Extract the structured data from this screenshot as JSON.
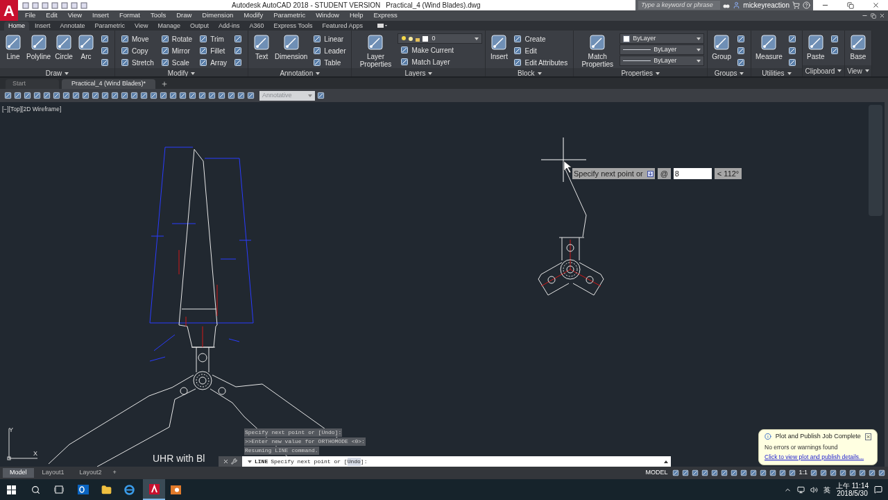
{
  "title_bar": {
    "logo": "A",
    "title": "Autodesk AutoCAD 2018 - STUDENT VERSION",
    "file": "Practical_4 (Wind Blades).dwg",
    "search_placeholder": "Type a keyword or phrase",
    "user": "mickeyreaction"
  },
  "menu": [
    "File",
    "Edit",
    "View",
    "Insert",
    "Format",
    "Tools",
    "Draw",
    "Dimension",
    "Modify",
    "Parametric",
    "Window",
    "Help",
    "Express"
  ],
  "ribbon_tabs": [
    {
      "label": "Home",
      "selected": true
    },
    {
      "label": "Insert",
      "selected": false
    },
    {
      "label": "Annotate",
      "selected": false
    },
    {
      "label": "Parametric",
      "selected": false
    },
    {
      "label": "View",
      "selected": false
    },
    {
      "label": "Manage",
      "selected": false
    },
    {
      "label": "Output",
      "selected": false
    },
    {
      "label": "Add-ins",
      "selected": false
    },
    {
      "label": "A360",
      "selected": false
    },
    {
      "label": "Express Tools",
      "selected": false
    },
    {
      "label": "Featured Apps",
      "selected": false
    }
  ],
  "panels": [
    {
      "title": "Draw",
      "items": [
        {
          "kind": "large",
          "label": "Line"
        },
        {
          "kind": "large",
          "label": "Polyline"
        },
        {
          "kind": "large",
          "label": "Circle"
        },
        {
          "kind": "large",
          "label": "Arc"
        },
        {
          "kind": "stack",
          "items": [
            {
              "kind": "icon"
            },
            {
              "kind": "icon"
            },
            {
              "kind": "icon"
            }
          ]
        }
      ]
    },
    {
      "title": "Modify",
      "items": [
        {
          "kind": "stack",
          "items": [
            {
              "kind": "small",
              "label": "Move"
            },
            {
              "kind": "small",
              "label": "Copy"
            },
            {
              "kind": "small",
              "label": "Stretch"
            }
          ]
        },
        {
          "kind": "stack",
          "items": [
            {
              "kind": "small",
              "label": "Rotate"
            },
            {
              "kind": "small",
              "label": "Mirror"
            },
            {
              "kind": "small",
              "label": "Scale"
            }
          ]
        },
        {
          "kind": "stack",
          "items": [
            {
              "kind": "small",
              "label": "Trim"
            },
            {
              "kind": "small",
              "label": "Fillet"
            },
            {
              "kind": "small",
              "label": "Array"
            }
          ]
        },
        {
          "kind": "stack",
          "items": [
            {
              "kind": "icon"
            },
            {
              "kind": "icon"
            },
            {
              "kind": "icon"
            }
          ]
        }
      ]
    },
    {
      "title": "Annotation",
      "items": [
        {
          "kind": "large",
          "label": "Text"
        },
        {
          "kind": "large",
          "label": "Dimension"
        },
        {
          "kind": "stack",
          "items": [
            {
              "kind": "small",
              "label": "Linear"
            },
            {
              "kind": "small",
              "label": "Leader"
            },
            {
              "kind": "small",
              "label": "Table"
            }
          ]
        }
      ]
    },
    {
      "title": "Layers",
      "items": [
        {
          "kind": "large",
          "label": "Layer Properties"
        },
        {
          "kind": "stack",
          "items": [
            {
              "kind": "layer_combo",
              "value": "0"
            },
            {
              "kind": "small",
              "label": "Make Current"
            },
            {
              "kind": "small",
              "label": "Match Layer"
            }
          ]
        }
      ]
    },
    {
      "title": "Block",
      "items": [
        {
          "kind": "large",
          "label": "Insert"
        },
        {
          "kind": "stack",
          "items": [
            {
              "kind": "small",
              "label": "Create"
            },
            {
              "kind": "small",
              "label": "Edit"
            },
            {
              "kind": "small",
              "label": "Edit Attributes"
            }
          ]
        }
      ]
    },
    {
      "title": "Properties",
      "items": [
        {
          "kind": "large",
          "label": "Match Properties"
        },
        {
          "kind": "stack",
          "items": [
            {
              "kind": "color_combo",
              "value": "ByLayer"
            },
            {
              "kind": "line_combo",
              "value": "ByLayer"
            },
            {
              "kind": "line_combo",
              "value": "ByLayer"
            }
          ]
        }
      ]
    },
    {
      "title": "Groups",
      "items": [
        {
          "kind": "large",
          "label": "Group"
        },
        {
          "kind": "stack",
          "items": [
            {
              "kind": "icon"
            },
            {
              "kind": "icon"
            },
            {
              "kind": "icon"
            }
          ]
        }
      ]
    },
    {
      "title": "Utilities",
      "items": [
        {
          "kind": "large",
          "label": "Measure"
        },
        {
          "kind": "stack",
          "items": [
            {
              "kind": "icon"
            },
            {
              "kind": "icon"
            },
            {
              "kind": "icon"
            }
          ]
        }
      ]
    },
    {
      "title": "Clipboard",
      "items": [
        {
          "kind": "large",
          "label": "Paste"
        },
        {
          "kind": "stack",
          "items": [
            {
              "kind": "icon"
            },
            {
              "kind": "icon"
            }
          ]
        }
      ]
    },
    {
      "title": "View",
      "items": [
        {
          "kind": "large",
          "label": "Base"
        }
      ]
    }
  ],
  "doc_tabs": [
    {
      "label": "Start",
      "selected": false
    },
    {
      "label": "Practical_4 (Wind Blades)*",
      "selected": true
    }
  ],
  "toolbar": {
    "style": "Annotative"
  },
  "viewport_label": "[−][Top][2D Wireframe]",
  "dynamic_input": {
    "prompt": "Specify next point or",
    "at": "@",
    "value": "8",
    "angle": "< 112°"
  },
  "ucs": {
    "x": "X",
    "y": "Y"
  },
  "drawing_note": "UHR with Bl",
  "command_history": [
    "Specify next point or [Undo]:",
    ">>Enter new value for ORTHOMODE <0>:",
    "Resuming LINE command."
  ],
  "command_line": {
    "command": "LINE",
    "prompt": "Specify next point or [",
    "option": "Undo",
    "end": "]:"
  },
  "layout_tabs": [
    {
      "label": "Model",
      "selected": true
    },
    {
      "label": "Layout1",
      "selected": false
    },
    {
      "label": "Layout2",
      "selected": false
    }
  ],
  "add_layout": "+",
  "status_bar": {
    "space": "MODEL",
    "scale": "1:1"
  },
  "notification": {
    "title": "Plot and Publish Job Complete",
    "message": "No errors or warnings found",
    "link": "Click to view plot and publish details..."
  },
  "taskbar": {
    "ime": "英",
    "time": "上午 11:14",
    "date": "2018/5/30"
  }
}
